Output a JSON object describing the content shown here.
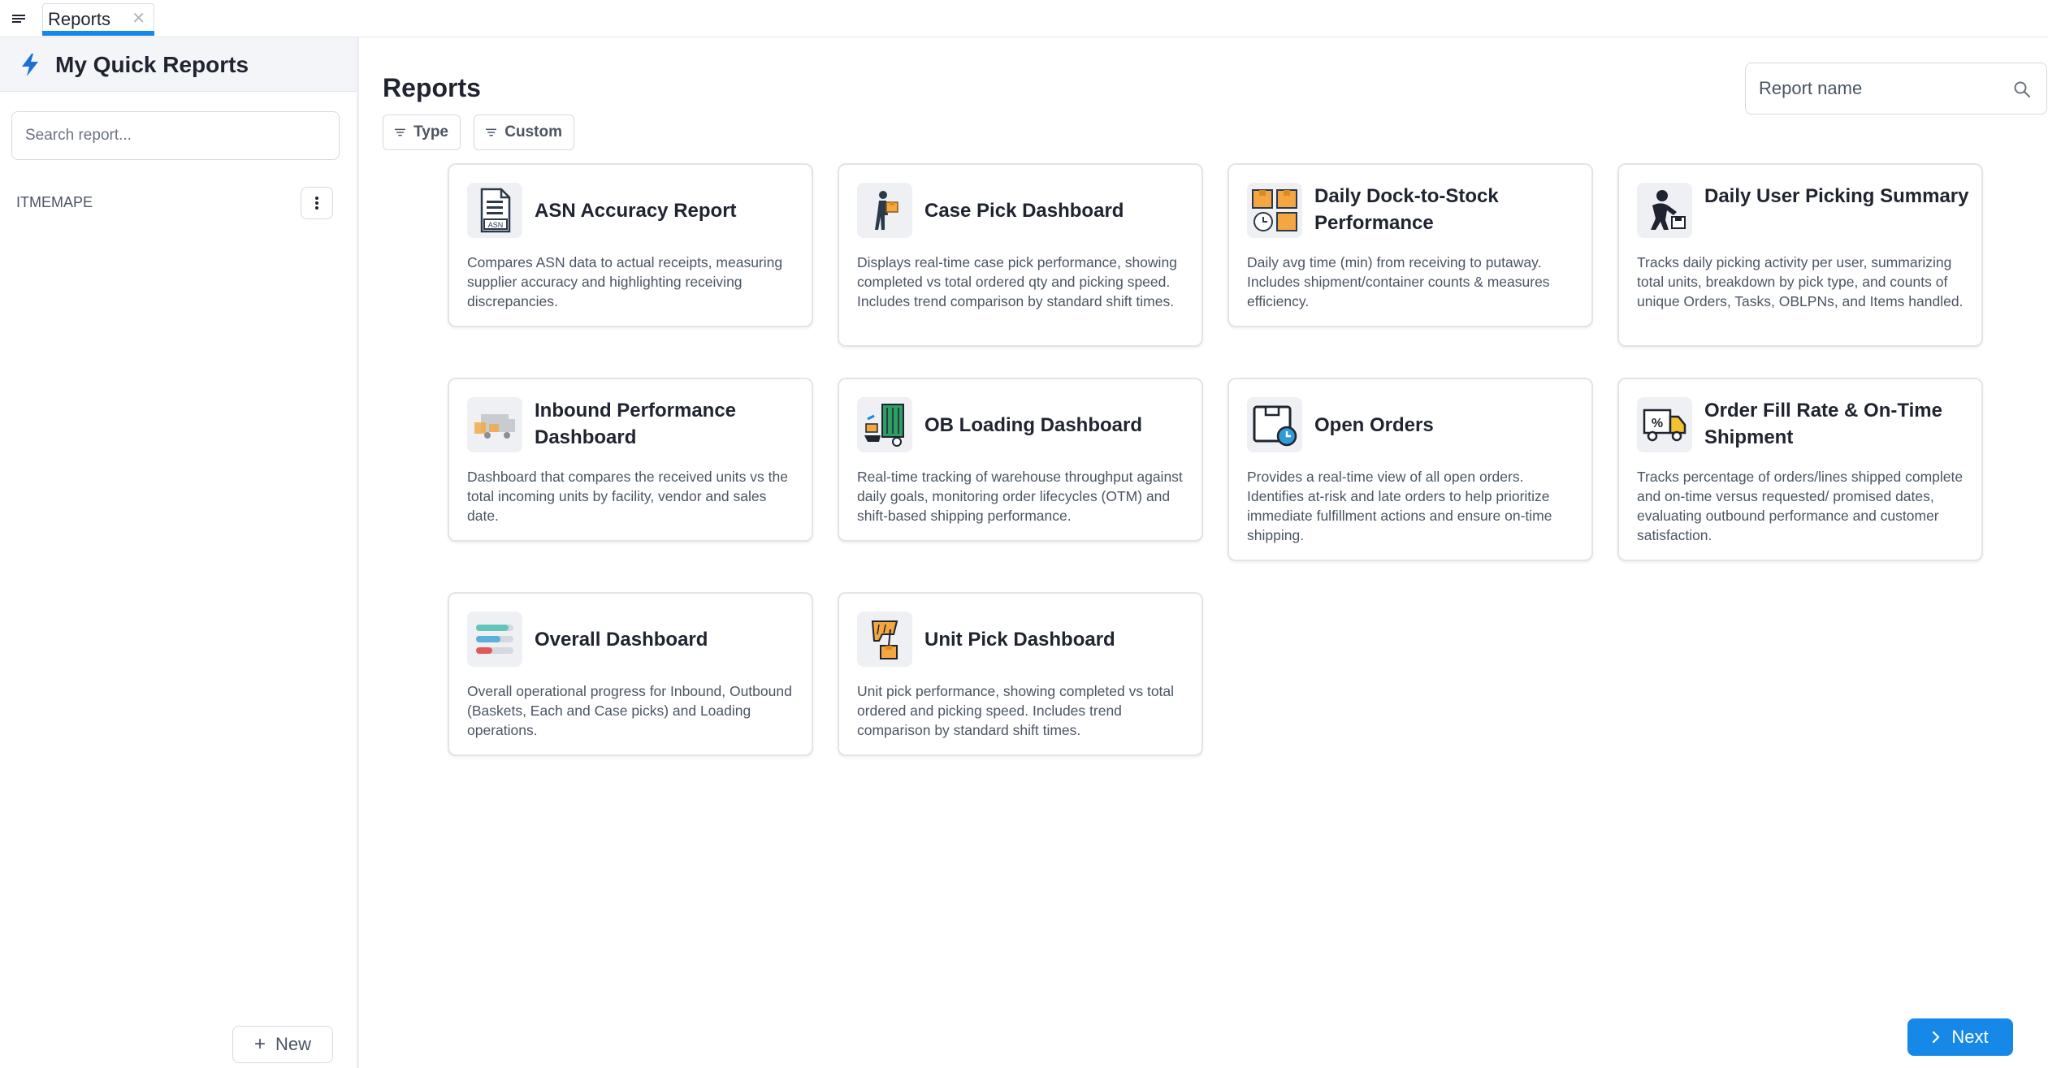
{
  "tab": {
    "label": "Reports"
  },
  "sidebar": {
    "title": "My Quick Reports",
    "search_placeholder": "Search report...",
    "items": [
      {
        "label": "ITMEMAPE"
      }
    ],
    "new_label": "New"
  },
  "main": {
    "title": "Reports",
    "search_placeholder": "Report name",
    "filters": {
      "type": "Type",
      "custom": "Custom"
    },
    "next_label": "Next"
  },
  "colors": {
    "accent": "#1688e8"
  },
  "reports": [
    {
      "title": "ASN Accuracy Report",
      "icon": "asn-document-icon",
      "description": "Compares ASN data to actual receipts, measuring supplier accuracy and highlighting receiving discrepancies."
    },
    {
      "title": "Case Pick Dashboard",
      "icon": "worker-carrying-box-icon",
      "description": "Displays real-time case pick performance, showing completed vs total ordered qty and picking speed. Includes trend comparison by standard shift times."
    },
    {
      "title": "Daily Dock-to-Stock Performance",
      "icon": "dock-to-stock-icon",
      "description": "Daily avg time (min) from receiving to putaway. Includes shipment/container counts & measures efficiency."
    },
    {
      "title": "Daily User Picking Summary",
      "icon": "worker-picking-icon",
      "description": "Tracks daily picking activity per user, summarizing total units, breakdown by pick type, and counts of unique Orders, Tasks, OBLPNs, and Items handled."
    },
    {
      "title": "Inbound Performance Dashboard",
      "icon": "inbound-truck-icon",
      "description": "Dashboard that compares the received units vs the total incoming units by facility, vendor and sales date."
    },
    {
      "title": "OB Loading Dashboard",
      "icon": "loading-truck-icon",
      "description": "Real-time tracking of warehouse throughput against daily goals, monitoring order lifecycles (OTM) and shift-based shipping performance."
    },
    {
      "title": "Open Orders",
      "icon": "open-box-clock-icon",
      "description": "Provides a real-time view of all open orders. Identifies at-risk and late orders to help prioritize immediate fulfillment actions and ensure on-time shipping."
    },
    {
      "title": "Order Fill Rate & On-Time Shipment",
      "icon": "delivery-truck-percent-icon",
      "description": "Tracks percentage of orders/lines shipped complete and on-time versus requested/ promised dates, evaluating outbound performance and customer satisfaction."
    },
    {
      "title": "Overall Dashboard",
      "icon": "progress-bars-icon",
      "description": "Overall operational progress for Inbound, Outbound (Baskets, Each and Case picks) and Loading operations."
    },
    {
      "title": "Unit Pick Dashboard",
      "icon": "hand-picking-box-icon",
      "description": "Unit pick performance, showing completed vs total ordered and picking speed. Includes trend comparison by standard shift times."
    }
  ]
}
